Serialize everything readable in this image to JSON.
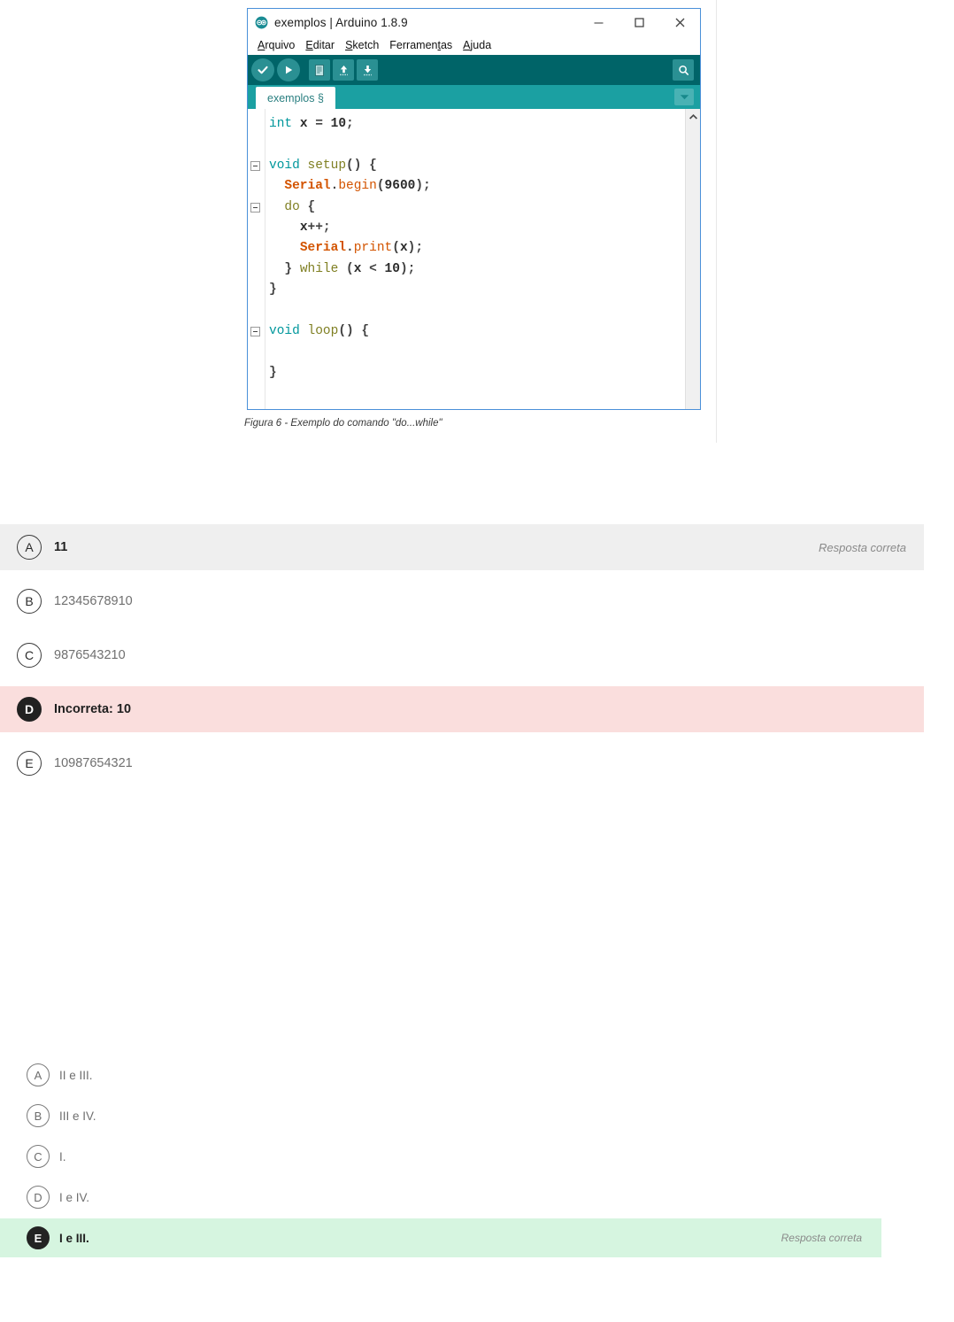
{
  "figure": {
    "ide": {
      "title": "exemplos | Arduino 1.8.9",
      "logo_icon": "arduino-infinity-logo",
      "window_controls": [
        {
          "name": "minimize",
          "icon": "minimize-icon"
        },
        {
          "name": "maximize",
          "icon": "maximize-icon"
        },
        {
          "name": "close",
          "icon": "close-icon"
        }
      ],
      "menus": [
        {
          "label": "Arquivo",
          "pre": "",
          "mnemonic": "A",
          "post": "rquivo"
        },
        {
          "label": "Editar",
          "pre": "",
          "mnemonic": "E",
          "post": "ditar"
        },
        {
          "label": "Sketch",
          "pre": "",
          "mnemonic": "S",
          "post": "ketch"
        },
        {
          "label": "Ferramentas",
          "pre": "Ferramen",
          "mnemonic": "t",
          "post": "as"
        },
        {
          "label": "Ajuda",
          "pre": "",
          "mnemonic": "A",
          "post": "juda"
        }
      ],
      "toolbar": [
        {
          "name": "verify-button",
          "icon": "check-icon",
          "tooltip": "Verificar"
        },
        {
          "name": "upload-button",
          "icon": "arrow-right-icon",
          "tooltip": "Carregar"
        },
        {
          "name": "new-button",
          "icon": "new-file-icon",
          "tooltip": "Novo"
        },
        {
          "name": "open-button",
          "icon": "arrow-up-icon",
          "tooltip": "Abrir"
        },
        {
          "name": "save-button",
          "icon": "arrow-down-icon",
          "tooltip": "Salvar"
        },
        {
          "name": "serial-monitor-button",
          "icon": "magnifier-icon",
          "tooltip": "Monitor serial"
        }
      ],
      "tab_label": "exemplos §",
      "tab_dropdown_icon": "chevron-down-icon",
      "scrollbar_up_icon": "chevron-up-icon",
      "code_lines": [
        {
          "indent": 0,
          "fold": false,
          "tokens": [
            {
              "t": "int",
              "c": "k-type"
            },
            {
              "t": " ",
              "c": "k-plain"
            },
            {
              "t": "x",
              "c": "k-plain"
            },
            {
              "t": " = ",
              "c": "k-punct"
            },
            {
              "t": "10",
              "c": "k-num"
            },
            {
              "t": ";",
              "c": "k-punct"
            }
          ]
        },
        {
          "indent": 0,
          "fold": false,
          "tokens": []
        },
        {
          "indent": 0,
          "fold": true,
          "tokens": [
            {
              "t": "void",
              "c": "k-type"
            },
            {
              "t": " ",
              "c": "k-plain"
            },
            {
              "t": "setup",
              "c": "k-func"
            },
            {
              "t": "() {",
              "c": "k-punct"
            }
          ]
        },
        {
          "indent": 1,
          "fold": false,
          "tokens": [
            {
              "t": "Serial",
              "c": "k-obj"
            },
            {
              "t": ".",
              "c": "k-punct"
            },
            {
              "t": "begin",
              "c": "k-meth"
            },
            {
              "t": "(",
              "c": "k-punct"
            },
            {
              "t": "9600",
              "c": "k-num"
            },
            {
              "t": ");",
              "c": "k-punct"
            }
          ]
        },
        {
          "indent": 1,
          "fold": true,
          "tokens": [
            {
              "t": "do",
              "c": "k-func"
            },
            {
              "t": " {",
              "c": "k-punct"
            }
          ]
        },
        {
          "indent": 2,
          "fold": false,
          "tokens": [
            {
              "t": "x",
              "c": "k-plain"
            },
            {
              "t": "++;",
              "c": "k-punct"
            }
          ]
        },
        {
          "indent": 2,
          "fold": false,
          "tokens": [
            {
              "t": "Serial",
              "c": "k-obj"
            },
            {
              "t": ".",
              "c": "k-punct"
            },
            {
              "t": "print",
              "c": "k-meth"
            },
            {
              "t": "(",
              "c": "k-punct"
            },
            {
              "t": "x",
              "c": "k-plain"
            },
            {
              "t": ");",
              "c": "k-punct"
            }
          ]
        },
        {
          "indent": 1,
          "fold": false,
          "tokens": [
            {
              "t": "} ",
              "c": "k-punct"
            },
            {
              "t": "while",
              "c": "k-func"
            },
            {
              "t": " (",
              "c": "k-punct"
            },
            {
              "t": "x",
              "c": "k-plain"
            },
            {
              "t": " < ",
              "c": "k-punct"
            },
            {
              "t": "10",
              "c": "k-num"
            },
            {
              "t": ");",
              "c": "k-punct"
            }
          ]
        },
        {
          "indent": 0,
          "fold": false,
          "tokens": [
            {
              "t": "}",
              "c": "k-punct"
            }
          ]
        },
        {
          "indent": 0,
          "fold": false,
          "tokens": []
        },
        {
          "indent": 0,
          "fold": true,
          "tokens": [
            {
              "t": "void",
              "c": "k-type"
            },
            {
              "t": " ",
              "c": "k-plain"
            },
            {
              "t": "loop",
              "c": "k-func"
            },
            {
              "t": "() {",
              "c": "k-punct"
            }
          ]
        },
        {
          "indent": 0,
          "fold": false,
          "tokens": []
        },
        {
          "indent": 0,
          "fold": false,
          "tokens": [
            {
              "t": "}",
              "c": "k-punct"
            }
          ]
        }
      ]
    },
    "caption": "Figura 6 - Exemplo do comando \"do...while\""
  },
  "question_1": {
    "options": [
      {
        "letter": "A",
        "text": "11",
        "state": "correct-answer",
        "status": "Resposta correta"
      },
      {
        "letter": "B",
        "text": "12345678910",
        "state": "normal",
        "status": ""
      },
      {
        "letter": "C",
        "text": "9876543210",
        "state": "normal",
        "status": ""
      },
      {
        "letter": "D",
        "text": "Incorreta: 10",
        "state": "selected-wrong",
        "status": ""
      },
      {
        "letter": "E",
        "text": "10987654321",
        "state": "normal",
        "status": ""
      }
    ]
  },
  "question_2": {
    "options": [
      {
        "letter": "A",
        "text": "II e III.",
        "state": "normal",
        "status": ""
      },
      {
        "letter": "B",
        "text": "III e IV.",
        "state": "normal",
        "status": ""
      },
      {
        "letter": "C",
        "text": "I.",
        "state": "normal",
        "status": ""
      },
      {
        "letter": "D",
        "text": "I e IV.",
        "state": "normal",
        "status": ""
      },
      {
        "letter": "E",
        "text": "I e III.",
        "state": "selected-correct",
        "status": "Resposta correta"
      }
    ]
  },
  "colors": {
    "ide_border": "#4a90d9",
    "toolbar_bg": "#006468",
    "tabbar_bg": "#1ba0a2",
    "button_bg": "#2a9093",
    "correct_green": "#d6f5e0",
    "wrong_red": "#fadedd",
    "neutral_gray": "#efefef",
    "keyword_type": "#00979c",
    "keyword_func": "#7f7f22",
    "keyword_obj": "#d35400"
  }
}
